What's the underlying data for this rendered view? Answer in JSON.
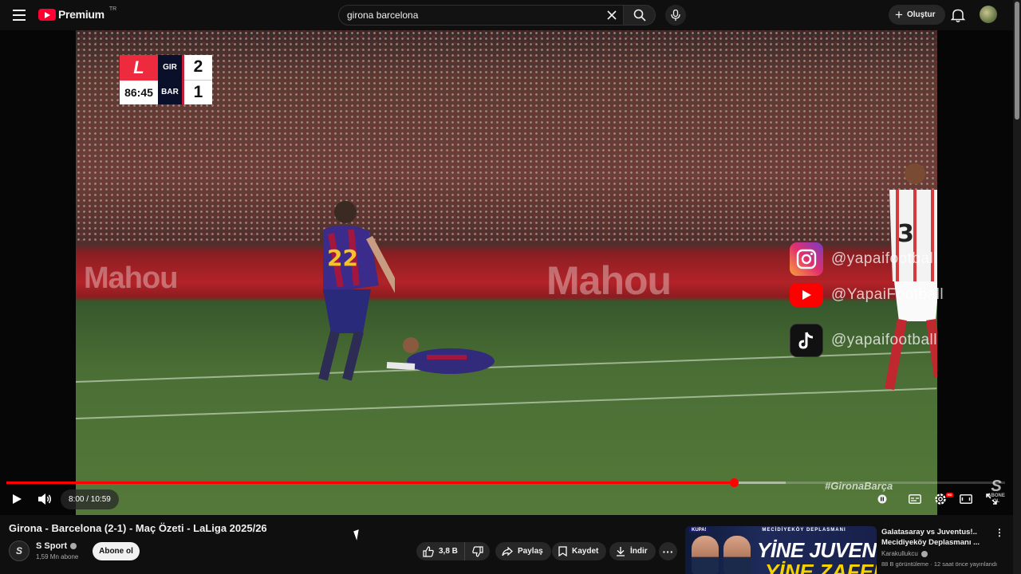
{
  "header": {
    "brand": "Premium",
    "country": "TR",
    "search_value": "girona barcelona",
    "create_label": "Oluştur"
  },
  "player": {
    "scoreboard": {
      "home": "GIR",
      "away": "BAR",
      "home_score": "2",
      "away_score": "1",
      "clock": "86:45"
    },
    "watermarks": [
      {
        "platform": "instagram-icon",
        "handle": "@yapaifootball"
      },
      {
        "platform": "youtube-icon",
        "handle": "@YapaiFootball"
      },
      {
        "platform": "tiktok-icon",
        "handle": "@yapaifootball"
      }
    ],
    "hashtag": "#GironaBarça",
    "abone_label_1": "ABONE",
    "abone_label_2": "OL",
    "abone_letter": "S",
    "time_display": "8:00 / 10:59",
    "current_seconds": 480,
    "duration_seconds": 659,
    "buffered_fraction": 0.78,
    "hd_badge": "HD",
    "colors": {
      "progress": "#ff0000"
    }
  },
  "video": {
    "title": "Girona - Barcelona (2-1) - Maç Özeti - LaLiga 2025/26",
    "channel": "S Sport",
    "channel_initial": "S",
    "subscribers": "1,59 Mn abone",
    "subscribe_label": "Abone ol",
    "likes": "3,8 B",
    "share_label": "Paylaş",
    "save_label": "Kaydet",
    "download_label": "İndir"
  },
  "recommendation": {
    "thumb_tag": "KUPA!",
    "thumb_band": "MECİDİYEKÖY DEPLASMANI",
    "thumb_line1": "YİNE JUVENTUS",
    "thumb_line2": "YİNE ZAFER?",
    "title": "Galatasaray vs Juventus!.. Mecidiyeköy Deplasmanı ...",
    "channel": "Karakullukcu",
    "meta": "88 B görüntüleme · 12 saat önce yayınlandı"
  }
}
